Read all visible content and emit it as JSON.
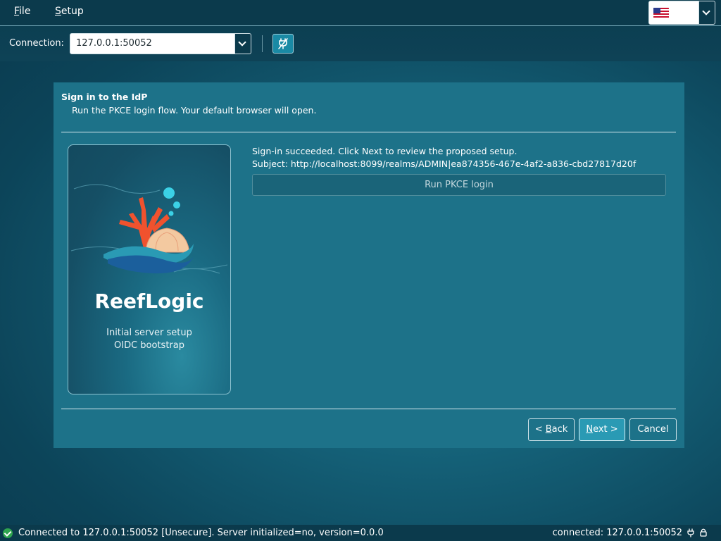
{
  "menubar": {
    "file": {
      "mnemonic": "F",
      "rest": "ile"
    },
    "setup": {
      "mnemonic": "S",
      "rest": "etup"
    },
    "language": {
      "flag_icon": "us-flag-icon",
      "dropdown_icon": "chevron-down-icon"
    }
  },
  "toolbar": {
    "connection_label": "Connection:",
    "connection_value": "127.0.0.1:50052",
    "disconnect_icon": "plug-slash-icon"
  },
  "wizard": {
    "title": "Sign in to the IdP",
    "subtitle": "Run the PKCE login flow. Your default browser will open.",
    "brand": {
      "name": "ReefLogic",
      "line1": "Initial server setup",
      "line2": "OIDC bootstrap",
      "logo_icon": "reef-coral-logo"
    },
    "status_line1": "Sign-in succeeded. Click Next to review the proposed setup.",
    "status_line2": "Subject: http://localhost:8099/realms/ADMIN|ea874356-467e-4af2-a836-cbd27817d20f",
    "run_button": "Run PKCE login",
    "buttons": {
      "back": {
        "pre": "< ",
        "mnemonic": "B",
        "rest": "ack"
      },
      "next": {
        "pre": "",
        "mnemonic": "N",
        "rest": "ext >"
      },
      "cancel": "Cancel"
    }
  },
  "statusbar": {
    "message": "Connected to 127.0.0.1:50052 [Unsecure]. Server initialized=no, version=0.0.0",
    "right": "connected: 127.0.0.1:50052",
    "icons": [
      "check-circle-icon",
      "plug-icon",
      "lock-icon"
    ],
    "colors": {
      "ok": "#2ea44f"
    }
  }
}
